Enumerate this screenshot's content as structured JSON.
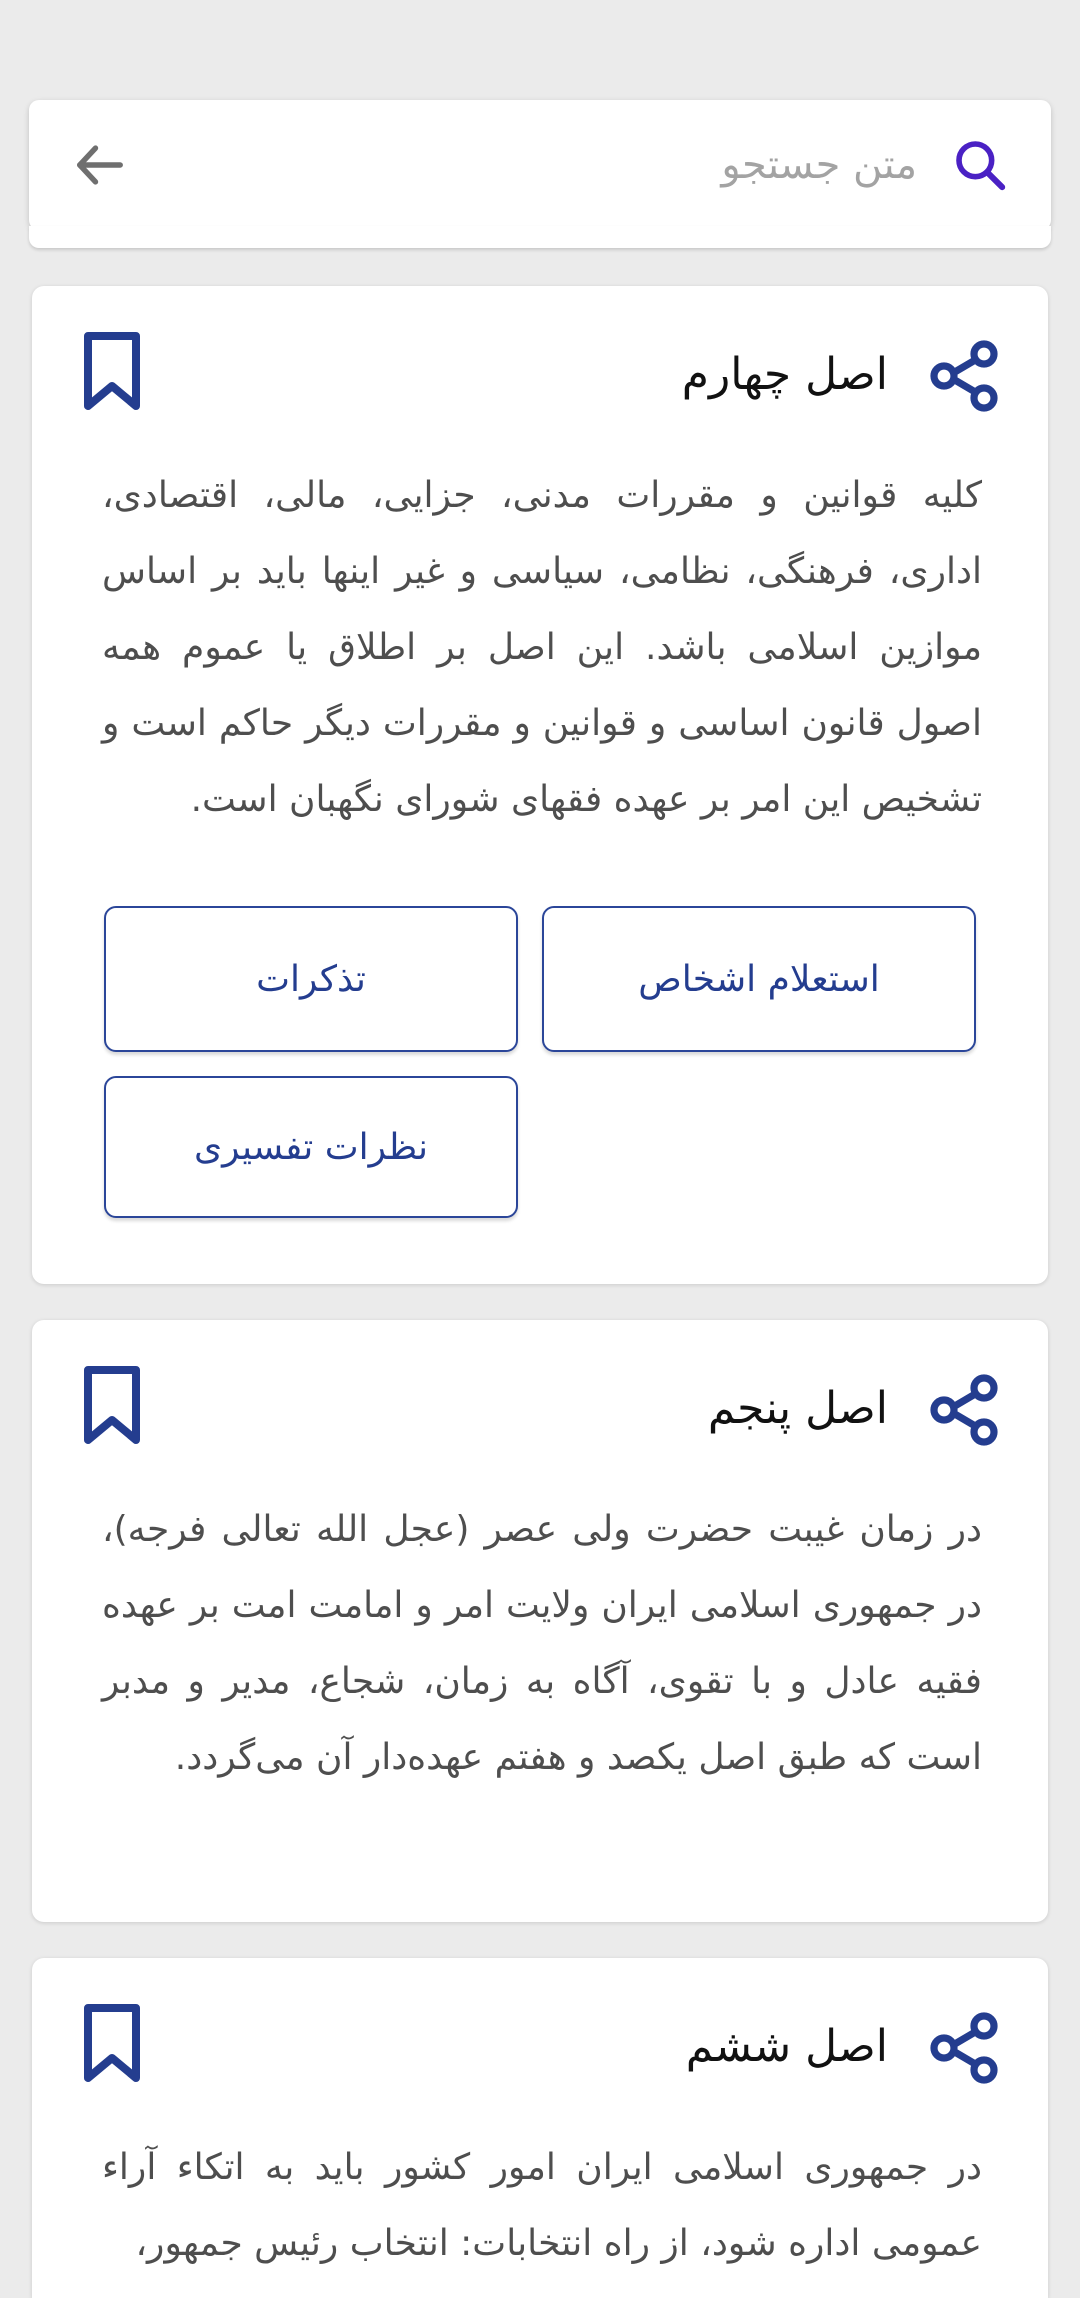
{
  "search": {
    "placeholder": "متن جستجو",
    "value": ""
  },
  "articles": [
    {
      "title": "اصل چهارم",
      "text": "کلیه قوانین و مقررات مدنی، جزایی، مالی، اقتصادی، اداری، فرهنگی، نظامی، سیاسی و غیر اینها باید بر اساس موازین اسلامی باشد. این اصل بر اطلاق یا عموم همه اصول قانون اساسی و قوانین و مقررات دیگر حاکم است و تشخیص این امر بر عهده فقهای شورای نگهبان است.",
      "actions": [
        "استعلام اشخاص",
        "تذکرات",
        "نظرات تفسیری"
      ]
    },
    {
      "title": "اصل پنجم",
      "text": "در زمان غیبت حضرت ولی عصر (عجل الله تعالی فرجه)، در جمهوری اسلامی ایران ولایت امر و امامت امت بر عهده فقیه عادل و با تقوی، آگاه به زمان، شجاع، مدیر و مدبر است که طبق اصل یکصد و هفتم عهده‌دار آن می‌گردد."
    },
    {
      "title": "اصل ششم",
      "text": "در جمهوری اسلامی ایران امور کشور باید به اتکاء آراء عمومی اداره شود، از راه انتخابات: انتخاب رئیس جمهور،"
    }
  ],
  "colors": {
    "accent": "#243d8f",
    "search_icon": "#4a21c4",
    "background": "#ebebeb"
  },
  "icons": {
    "search": "search-icon",
    "back": "arrow-left-icon",
    "share": "share-icon",
    "bookmark": "bookmark-icon"
  }
}
